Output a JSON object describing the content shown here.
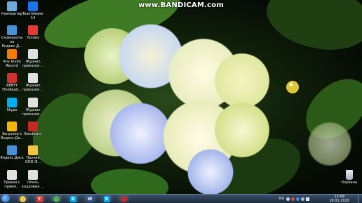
{
  "watermark": "www.BANDICAM.com",
  "desktop_icons": [
    {
      "label": "Компьютер",
      "icon": "computer-icon",
      "color": "#6fa8dc"
    },
    {
      "label": "TeamViewer\n14",
      "icon": "teamviewer-icon",
      "color": "#1a73e8"
    },
    {
      "label": "Скриншоты\nна Яндекс.Д...",
      "icon": "yandex-disk-screenshots-icon",
      "color": "#4a90d9"
    },
    {
      "label": "Yandex",
      "icon": "yandex-browser-icon",
      "color": "#e53935"
    },
    {
      "label": "Any Audio\nRecord",
      "icon": "audio-record-icon",
      "color": "#f57c00"
    },
    {
      "label": "Журнал\nприказов ...",
      "icon": "document-icon",
      "color": "#e0e0e0"
    },
    {
      "label": "ABBYY\nFineRead...",
      "icon": "abbyy-icon",
      "color": "#d32f2f"
    },
    {
      "label": "Журнал\nприказов ...",
      "icon": "document-icon",
      "color": "#e0e0e0"
    },
    {
      "label": "Skype",
      "icon": "skype-icon",
      "color": "#00aff0"
    },
    {
      "label": "Журнал\nприказов ...",
      "icon": "document-icon",
      "color": "#e0e0e0"
    },
    {
      "label": "Загрузки к\nЯндекс.Ди...",
      "icon": "yandex-disk-downloads-icon",
      "color": "#f4b400"
    },
    {
      "label": "Bandicam",
      "icon": "bandicam-icon",
      "color": "#c62828"
    },
    {
      "label": "Яндекс.Диск",
      "icon": "yandex-disk-icon",
      "color": "#4a90d9"
    },
    {
      "label": "Прочие\nООО Ф...",
      "icon": "folder-icon",
      "color": "#f4c542"
    },
    {
      "label": "Приказ с\nприем...",
      "icon": "document-icon",
      "color": "#e0e0e0"
    },
    {
      "label": "Опись\nкадровых ...",
      "icon": "document-icon",
      "color": "#e0e0e0"
    }
  ],
  "recycle_bin": {
    "label": "Корзина",
    "icon": "recycle-bin-icon"
  },
  "taskbar": {
    "pinned": [
      {
        "icon": "explorer-folder-icon",
        "glyph": "",
        "color": "#f4c542"
      },
      {
        "icon": "yandex-browser-icon",
        "glyph": "Y",
        "color": "#e53935"
      },
      {
        "icon": "chrome-icon",
        "glyph": "",
        "color": "#4caf50"
      },
      {
        "icon": "skype-icon",
        "glyph": "S",
        "color": "#00aff0"
      },
      {
        "icon": "word-icon",
        "glyph": "W",
        "color": "#2b579a"
      },
      {
        "icon": "skype-app-icon",
        "glyph": "S",
        "color": "#00aff0"
      },
      {
        "icon": "bandicam-recording-icon",
        "glyph": "",
        "color": "#c62828"
      }
    ],
    "language": "RU",
    "time": "12:09",
    "date": "18.01.2020"
  }
}
